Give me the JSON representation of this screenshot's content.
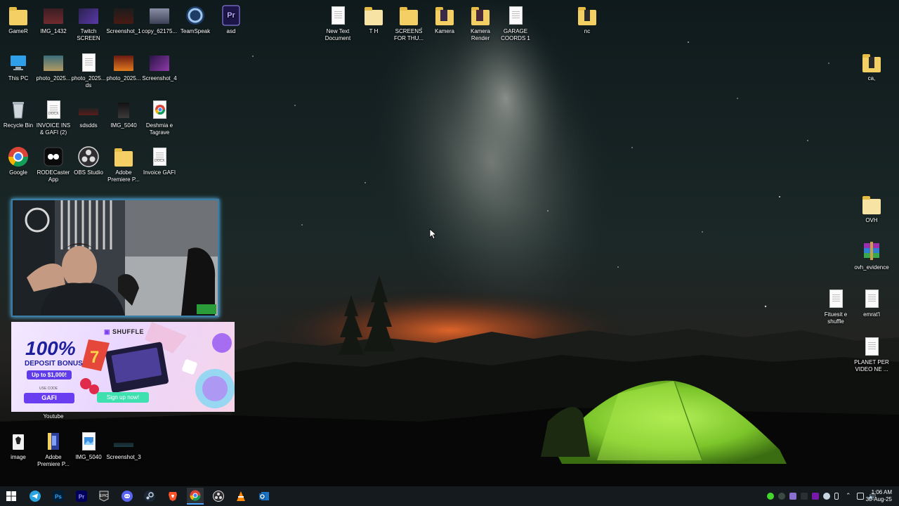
{
  "desktop": {
    "icons": [
      {
        "label": "GameR"
      },
      {
        "label": "IMG_1432"
      },
      {
        "label": "Twitch SCREEN"
      },
      {
        "label": "Screenshot_1"
      },
      {
        "label": "copy_62175..."
      },
      {
        "label": "TeamSpeak"
      },
      {
        "label": "asd"
      },
      {
        "label": "This PC"
      },
      {
        "label": "photo_2025..."
      },
      {
        "label": "photo_2025... ds"
      },
      {
        "label": "photo_2025..."
      },
      {
        "label": "Screenshot_4"
      },
      {
        "label": "Recycle Bin"
      },
      {
        "label": "INVOICE INS & GAFI (2)"
      },
      {
        "label": "sdsdds"
      },
      {
        "label": "IMG_5040"
      },
      {
        "label": "Deshmia e Tagrave"
      },
      {
        "label": "Google"
      },
      {
        "label": "RODECaster App"
      },
      {
        "label": "OBS Studio"
      },
      {
        "label": "Adobe Premiere P..."
      },
      {
        "label": "Invoice GAFI"
      },
      {
        "label": "Youtube"
      },
      {
        "label": "image"
      },
      {
        "label": "Adobe Premiere P..."
      },
      {
        "label": "IMG_5040"
      },
      {
        "label": "Screenshot_3"
      },
      {
        "label": "New Text Document"
      },
      {
        "label": "T H"
      },
      {
        "label": "SCREENS FOR THU..."
      },
      {
        "label": "Kamera"
      },
      {
        "label": "Kamera Render"
      },
      {
        "label": "GARAGE COORDS 1"
      },
      {
        "label": "nc"
      },
      {
        "label": "ca,"
      },
      {
        "label": "OVH"
      },
      {
        "label": "ovh_evidence"
      },
      {
        "label": "Fituesit e shuffle"
      },
      {
        "label": "emrat'l"
      },
      {
        "label": "PLANET PER VIDEO NE ..."
      }
    ]
  },
  "promo": {
    "brand": "SHUFFLE",
    "headline": "100%",
    "subheadline": "DEPOSIT BONUS",
    "amount": "Up to $1,000!",
    "code_label": "USE CODE",
    "code": "GAFI",
    "cta": "Sign up now!"
  },
  "taskbar": {
    "apps": [
      "start",
      "telegram",
      "photoshop",
      "premiere",
      "epic-games",
      "discord",
      "steam",
      "brave",
      "chrome",
      "obs",
      "vlc",
      "outlook"
    ]
  },
  "clock": {
    "time": "1:06 AM",
    "date": "30-Aug-25"
  },
  "colors": {
    "taskbar": "#151a1e",
    "tent": "#8fd63a",
    "accent": "#1e88e5"
  }
}
